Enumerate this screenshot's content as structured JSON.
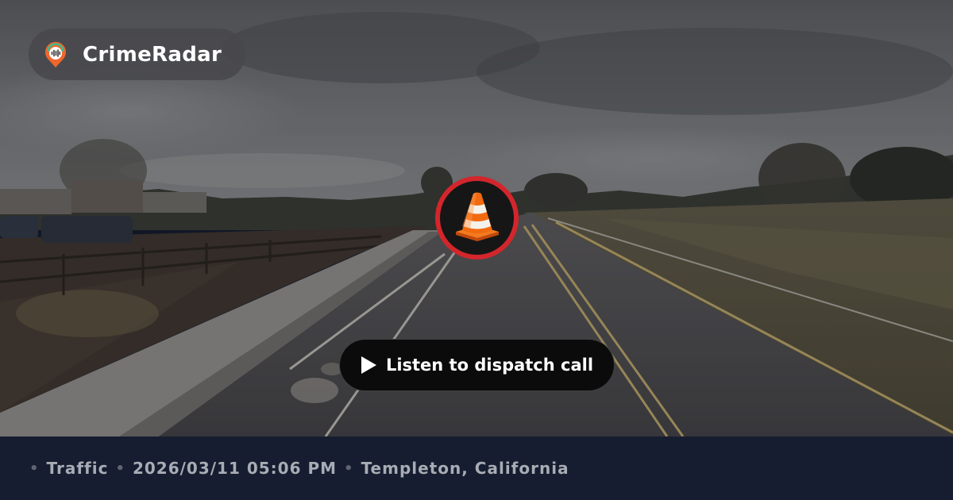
{
  "brand": {
    "name": "CrimeRadar",
    "logo_icon": "crimeradar-pin-logo-icon",
    "logo_colors": [
      "#f0662b",
      "#3fb98a",
      "#ffffff"
    ]
  },
  "incident": {
    "icon": "traffic-cone-icon",
    "badge_color": "#d3262c"
  },
  "audio": {
    "play_label": "Listen to dispatch call",
    "icon": "play-icon"
  },
  "details": {
    "category": "Traffic",
    "datetime": "2026/03/11 05:06 PM",
    "location": "Templeton, California",
    "separator": "•"
  },
  "scene": {
    "description_icon": "street-photo-background"
  }
}
